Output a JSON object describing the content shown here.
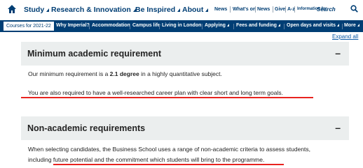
{
  "top_nav": {
    "items": [
      "Study",
      "Research & Innovation",
      "Be Inspired",
      "About"
    ],
    "small_links": [
      "News",
      "What's on",
      "News",
      "Give",
      "A-z",
      "Information for"
    ],
    "search_label": "Search"
  },
  "sub_nav": {
    "courses": "Courses for 2021-22",
    "items": [
      "Why Imperial?",
      "Accommodation",
      "Campus life",
      "Living in London",
      "Applying",
      "Fees and funding",
      "Open days and visits",
      "More"
    ]
  },
  "expand_all": "Expand all",
  "sections": [
    {
      "title": "Minimum academic requirement",
      "toggle": "–",
      "line1_pre": "Our minimum requirement is a ",
      "line1_bold": "2.1 degree",
      "line1_post": " in a highly quantitative subject.",
      "line2": "You are also required to have a well-researched career plan with clear short and long term goals."
    },
    {
      "title": "Non-academic requirements",
      "toggle": "–",
      "line1": "When selecting candidates, the Business School uses a range of non-academic criteria to assess students,",
      "line2": "including future potential and the commitment which students will bring to the programme."
    }
  ],
  "colors": {
    "brand_navy": "#003e74",
    "panel_bg": "#ebeeee",
    "annotation_red": "#e8231f",
    "link_blue": "#0b5aa6"
  }
}
